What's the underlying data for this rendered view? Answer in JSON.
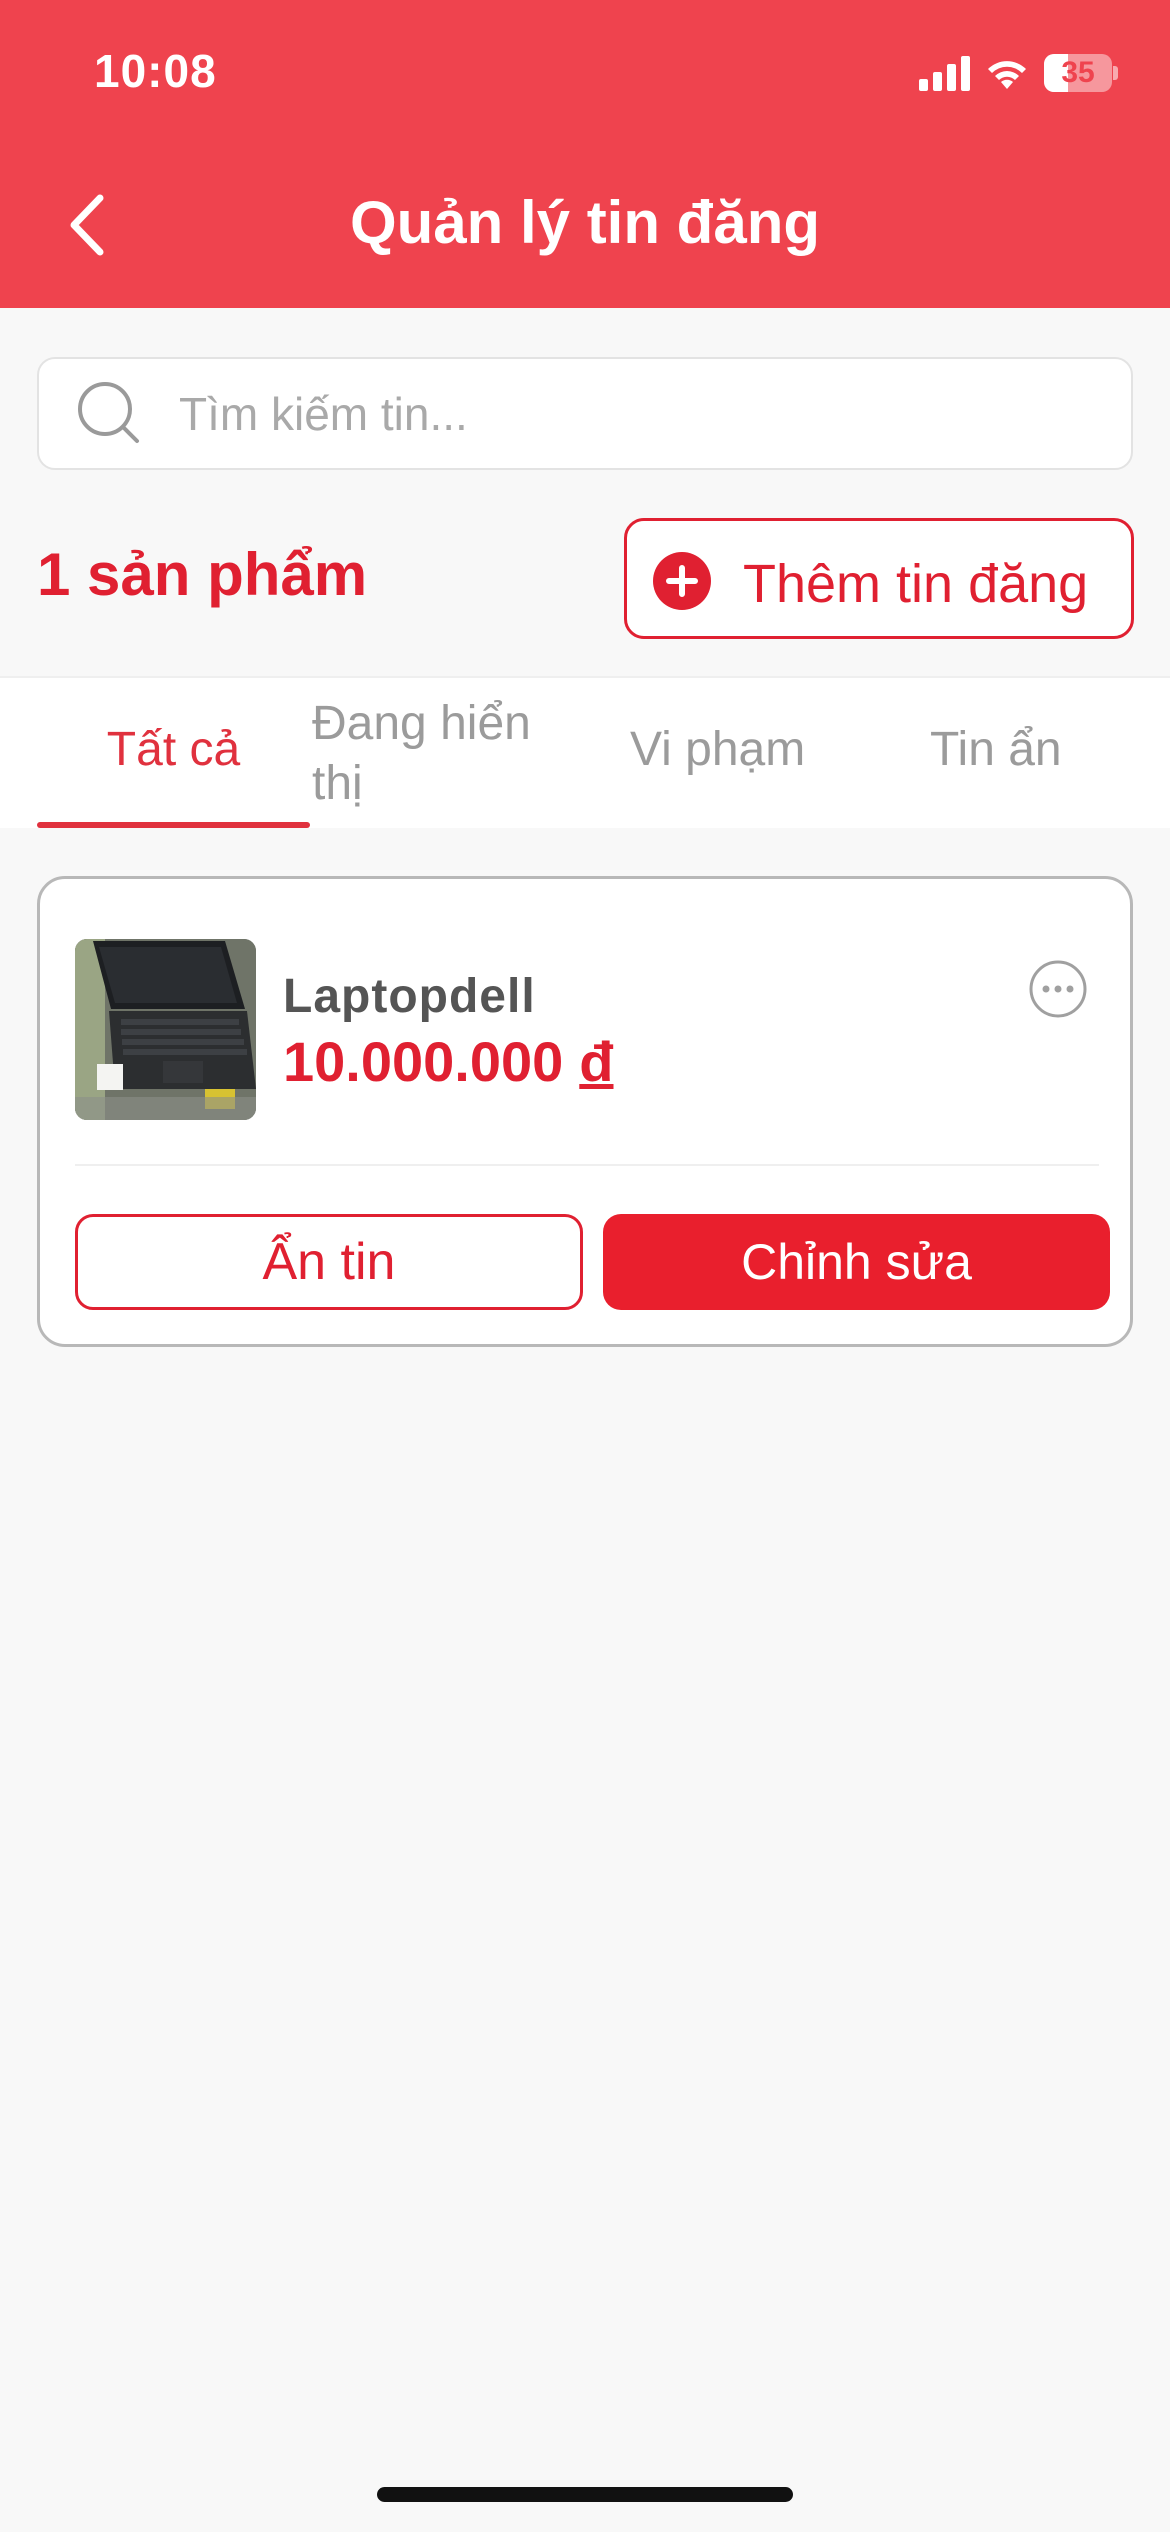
{
  "status_bar": {
    "time": "10:08",
    "battery_level": "35",
    "battery_fraction": 0.35
  },
  "header": {
    "title": "Quản lý tin đăng",
    "background_color": "#ef434e",
    "back_icon": "chevron-left-icon"
  },
  "search": {
    "placeholder": "Tìm kiếm tin...",
    "value": "",
    "icon": "search-icon"
  },
  "summary": {
    "count_label": "1 sản phẩm",
    "add_button_label": "Thêm tin đăng",
    "add_icon": "plus-circle-icon"
  },
  "tabs": [
    {
      "label": "Tất cả",
      "active": true
    },
    {
      "label": "Đang hiển thị",
      "active": false
    },
    {
      "label": "Vi phạm",
      "active": false
    },
    {
      "label": "Tin ẩn",
      "active": false
    }
  ],
  "listings": [
    {
      "name": "Laptopdell",
      "price": "10.000.000",
      "currency": "đ",
      "thumbnail": "laptop-photo",
      "more_icon": "ellipsis-circle-icon",
      "hide_button_label": "Ẩn tin",
      "edit_button_label": "Chỉnh sửa"
    }
  ],
  "colors": {
    "accent": "#e02031",
    "tab_inactive": "#9b9b9b",
    "page_background": "#f8f8f8"
  }
}
